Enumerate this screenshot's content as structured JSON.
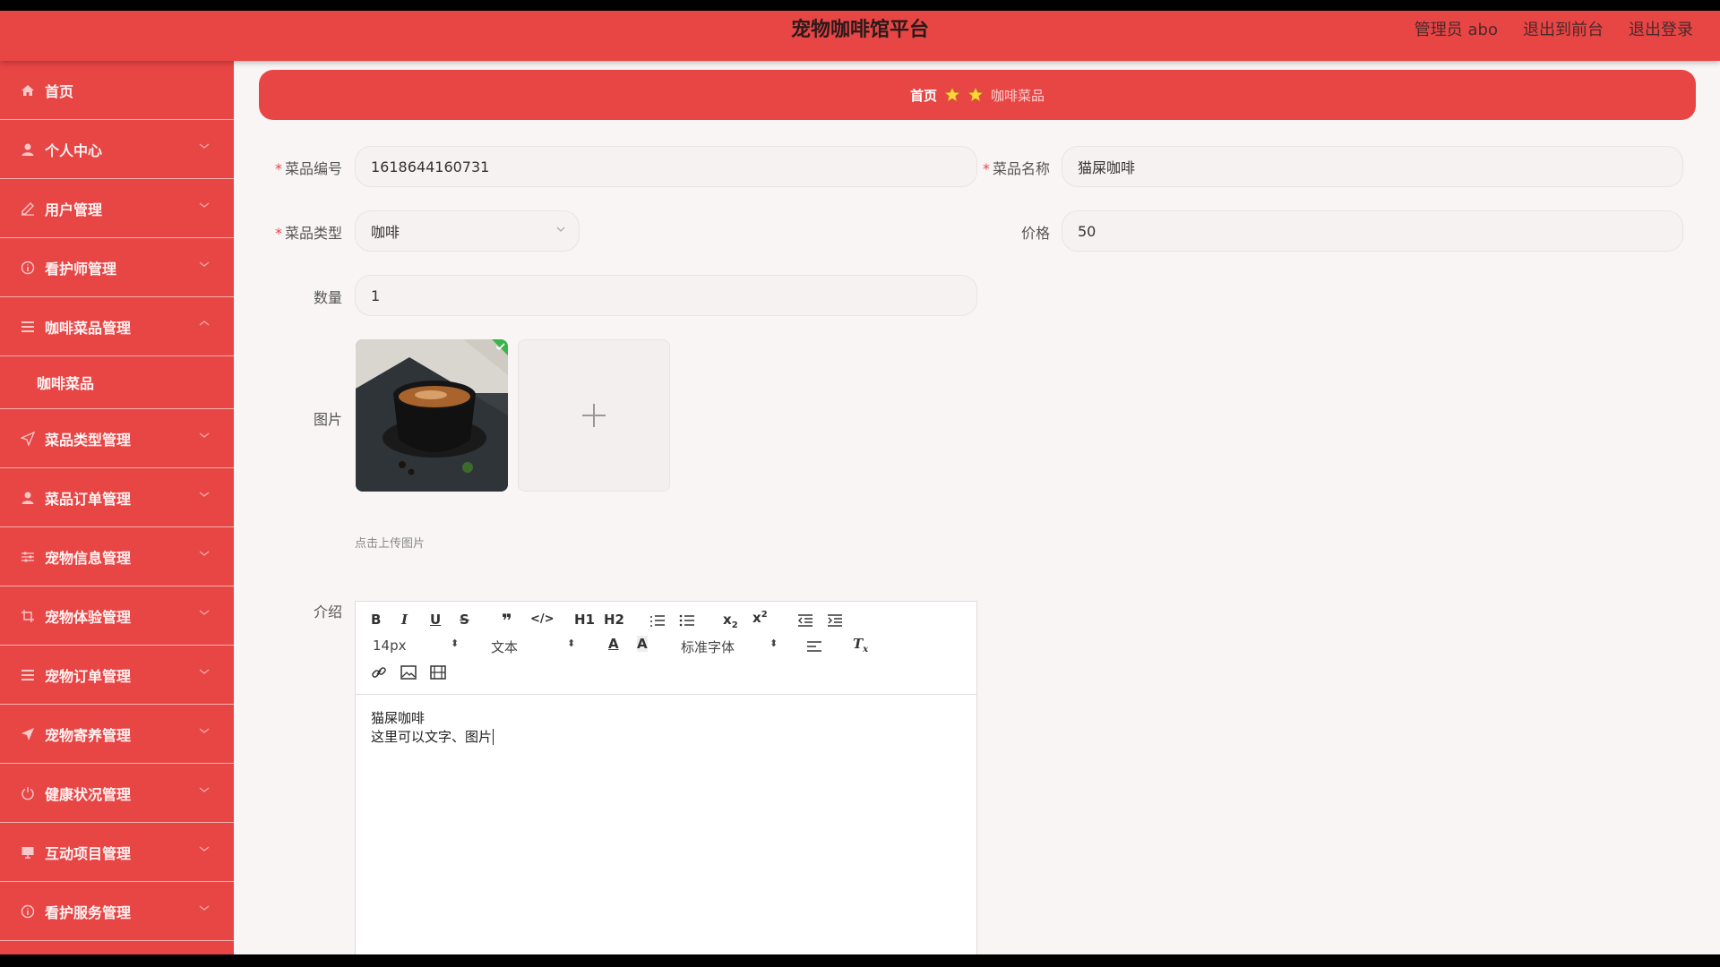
{
  "app": {
    "title": "宠物咖啡馆平台"
  },
  "header": {
    "admin": "管理员 abo",
    "to_front": "退出到前台",
    "logout": "退出登录"
  },
  "sidebar": {
    "items": [
      {
        "label": "首页",
        "icon": "home-icon"
      },
      {
        "label": "个人中心",
        "icon": "user-icon"
      },
      {
        "label": "用户管理",
        "icon": "edit-icon"
      },
      {
        "label": "看护师管理",
        "icon": "info-circle-icon"
      },
      {
        "label": "咖啡菜品管理",
        "icon": "list-icon",
        "expanded": true,
        "children": [
          "咖啡菜品"
        ]
      },
      {
        "label": "菜品类型管理",
        "icon": "send-icon"
      },
      {
        "label": "菜品订单管理",
        "icon": "user-icon"
      },
      {
        "label": "宠物信息管理",
        "icon": "sliders-icon"
      },
      {
        "label": "宠物体验管理",
        "icon": "crop-icon"
      },
      {
        "label": "宠物订单管理",
        "icon": "list-icon"
      },
      {
        "label": "宠物寄养管理",
        "icon": "send-icon"
      },
      {
        "label": "健康状况管理",
        "icon": "power-icon"
      },
      {
        "label": "互动项目管理",
        "icon": "monitor-icon"
      },
      {
        "label": "看护服务管理",
        "icon": "info-circle-icon"
      }
    ]
  },
  "breadcrumb": {
    "home": "首页",
    "current": "咖啡菜品"
  },
  "form": {
    "code": {
      "label": "菜品编号",
      "value": "1618644160731"
    },
    "name": {
      "label": "菜品名称",
      "value": "猫屎咖啡"
    },
    "type": {
      "label": "菜品类型",
      "value": "咖啡"
    },
    "price": {
      "label": "价格",
      "value": "50"
    },
    "qty": {
      "label": "数量",
      "value": "1"
    },
    "image": {
      "label": "图片",
      "tip": "点击上传图片"
    },
    "intro": {
      "label": "介绍"
    }
  },
  "editor": {
    "font_size": "14px",
    "block_format": "文本",
    "font_family": "标准字体",
    "h1": "H1",
    "h2": "H2",
    "content_line1": "猫屎咖啡",
    "content_line2": "这里可以文字、图片"
  },
  "colors": {
    "accent": "#e84545",
    "background": "#f9f5f5"
  }
}
